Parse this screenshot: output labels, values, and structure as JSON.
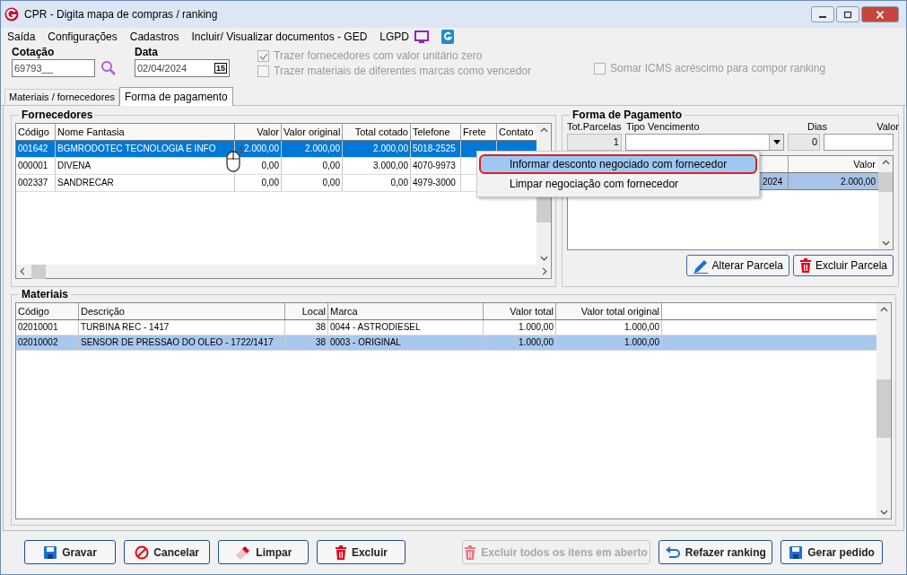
{
  "window": {
    "title": "CPR - Digita mapa de compras / ranking"
  },
  "menu": [
    "Saída",
    "Configurações",
    "Cadastros",
    "Incluir/ Visualizar documentos - GED",
    "LGPD"
  ],
  "fields": [
    {
      "label": "Cotação",
      "value": "69793__",
      "kind": "search"
    },
    {
      "label": "Data",
      "value": "02/04/2024",
      "kind": "date",
      "calendar": "15"
    }
  ],
  "options": [
    {
      "label": "Trazer fornecedores com valor unitário zero",
      "checked": true,
      "disabled": true
    },
    {
      "label": "Trazer materiais de diferentes marcas como vencedor",
      "checked": false,
      "disabled": true
    },
    {
      "label": "Somar ICMS acréscimo para compor ranking",
      "checked": false,
      "disabled": true
    }
  ],
  "tabs": [
    {
      "label": "Materiais / fornecedores",
      "selected": false
    },
    {
      "label": "Forma de pagamento",
      "selected": true
    }
  ],
  "suppliers": {
    "title": "Fornecedores",
    "columns": [
      "Código",
      "Nome Fantasia",
      "Valor",
      "Valor original",
      "Total cotado",
      "Telefone",
      "Frete",
      "Contato"
    ],
    "rows": [
      {
        "selected": true,
        "cells": [
          "001642",
          "BGMRODOTEC TECNOLOGIA E INFO",
          "2.000,00",
          "2.000,00",
          "2.000,00",
          "5018-2525",
          "",
          ""
        ]
      },
      {
        "selected": false,
        "cells": [
          "000001",
          "DIVENA",
          "0,00",
          "0,00",
          "3.000,00",
          "4070-9973",
          "",
          ""
        ]
      },
      {
        "selected": false,
        "cells": [
          "002337",
          "SANDRECAR",
          "0,00",
          "0,00",
          "0,00",
          "4979-3000",
          "",
          ""
        ]
      }
    ]
  },
  "payment": {
    "title": "Forma de Pagamento",
    "labels": [
      "Tot.Parcelas",
      "Tipo Vencimento",
      "Dias",
      "Valor"
    ],
    "parcelas": "1",
    "dias": "0",
    "grid_header": [
      "Valor"
    ],
    "grid_row": [
      "2024",
      "2.000,00"
    ],
    "buttons": [
      "Alterar Parcela",
      "Excluir Parcela"
    ]
  },
  "materials": {
    "title": "Materiais",
    "columns": [
      "Código",
      "Descrição",
      "Local",
      "Marca",
      "Valor total",
      "Valor total original"
    ],
    "rows": [
      {
        "selected": false,
        "cells": [
          "02010001",
          "TURBINA REC - 1417",
          "38",
          "0044 - ASTRODIESEL",
          "1.000,00",
          "1.000,00"
        ]
      },
      {
        "selected": true,
        "cells": [
          "02010002",
          "SENSOR DE PRESSAO DO OLEO - 1722/1417",
          "38",
          "0003 - ORIGINAL",
          "1.000,00",
          "1.000,00"
        ]
      }
    ]
  },
  "context_menu": [
    {
      "label": "Informar desconto negociado com fornecedor",
      "selected": true
    },
    {
      "label": "Limpar negociação com fornecedor",
      "selected": false
    }
  ],
  "buttons": [
    {
      "label": "Gravar",
      "disabled": false
    },
    {
      "label": "Cancelar",
      "disabled": false
    },
    {
      "label": "Limpar",
      "disabled": false
    },
    {
      "label": "Excluir",
      "disabled": false
    },
    {
      "label": "Excluir todos os itens em aberto",
      "disabled": true
    },
    {
      "label": "Refazer ranking",
      "disabled": false
    },
    {
      "label": "Gerar pedido",
      "disabled": false
    }
  ]
}
